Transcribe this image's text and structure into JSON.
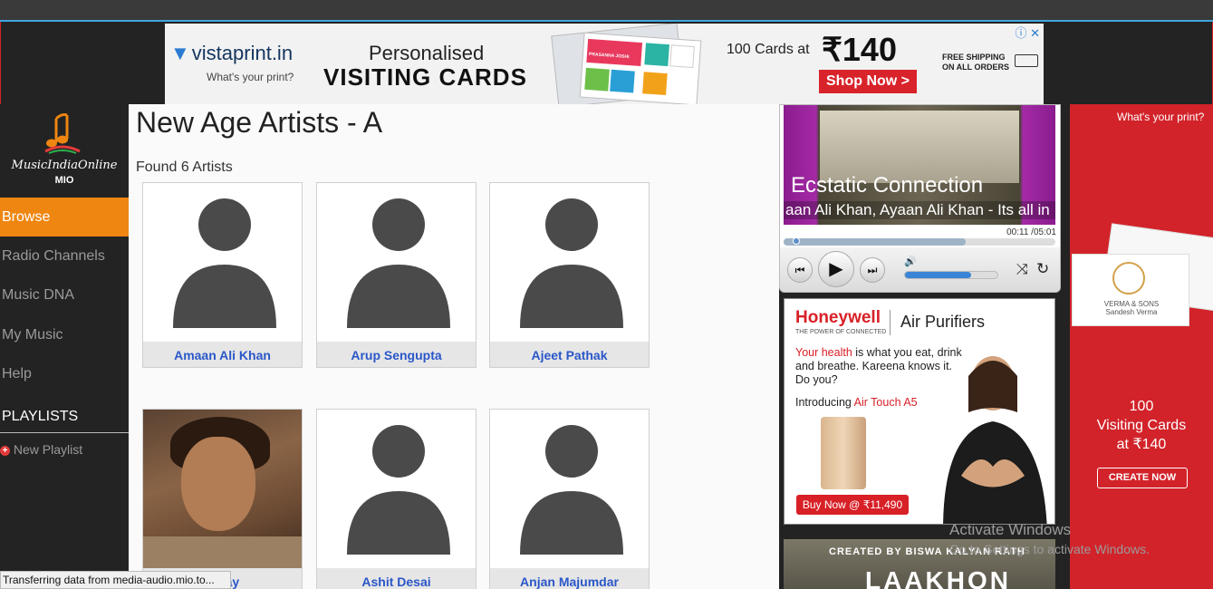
{
  "top_ad": {
    "brand": "vistaprint.in",
    "tagline": "What's your print?",
    "headline1": "Personalised",
    "headline2": "VISITING CARDS",
    "price_label": "100 Cards at",
    "price": "₹140",
    "cta": "Shop Now >",
    "shipping_line1": "FREE SHIPPING",
    "shipping_line2": "ON ALL ORDERS",
    "card_name": "PRASANNA JOSHI"
  },
  "sidebar": {
    "logo_text": "MusicIndiaOnline",
    "logo_sub": "MIO",
    "nav": [
      {
        "label": "Browse",
        "active": true
      },
      {
        "label": "Radio Channels",
        "active": false
      },
      {
        "label": "Music DNA",
        "active": false
      },
      {
        "label": "My Music",
        "active": false
      },
      {
        "label": "Help",
        "active": false
      }
    ],
    "playlists_heading": "PLAYLISTS",
    "new_playlist": "New Playlist"
  },
  "main": {
    "title": "New Age Artists - A",
    "found_text": "Found 6 Artists",
    "artists": [
      {
        "name": "Amaan Ali Khan",
        "has_photo": false
      },
      {
        "name": "Arup Sengupta",
        "has_photo": false
      },
      {
        "name": "Ajeet Pathak",
        "has_photo": false
      },
      {
        "name": "k Ray",
        "has_photo": true
      },
      {
        "name": "Ashit Desai",
        "has_photo": false
      },
      {
        "name": "Anjan Majumdar",
        "has_photo": false
      }
    ]
  },
  "player": {
    "track_title": "Ecstatic Connection",
    "track_sub": "aan Ali Khan, Ayaan Ali Khan - Its all in",
    "time": "00:11 /05:01",
    "progress_fraction": 0.67,
    "volume_fraction": 0.72
  },
  "honeywell_ad": {
    "brand": "Honeywell",
    "brand_sub": "THE POWER OF CONNECTED",
    "product": "Air Purifiers",
    "copy_red": "Your health",
    "copy_rest": " is what you eat, drink and breathe. Kareena knows it. Do you?",
    "intro": "Introducing",
    "intro_product": "Air Touch A5",
    "cta": "Buy Now @ ₹11,490"
  },
  "lower_ad": {
    "credit": "CREATED BY BISWA KALYAN RATH",
    "title": "LAAKHON"
  },
  "right_ad": {
    "tagline": "What's your print?",
    "card_name": "VERMA & SONS",
    "card_person": "Sandesh Verma",
    "line1": "100",
    "line2": "Visiting Cards",
    "line3": "at ₹140",
    "cta": "CREATE NOW"
  },
  "watermark": {
    "line1": "Activate Windows",
    "line2": "Go to Settings to activate Windows."
  },
  "status_bar": "Transferring data from media-audio.mio.to...",
  "colors": {
    "accent": "#ee8611",
    "link": "#2a57c8",
    "ad_red": "#d2232a"
  }
}
